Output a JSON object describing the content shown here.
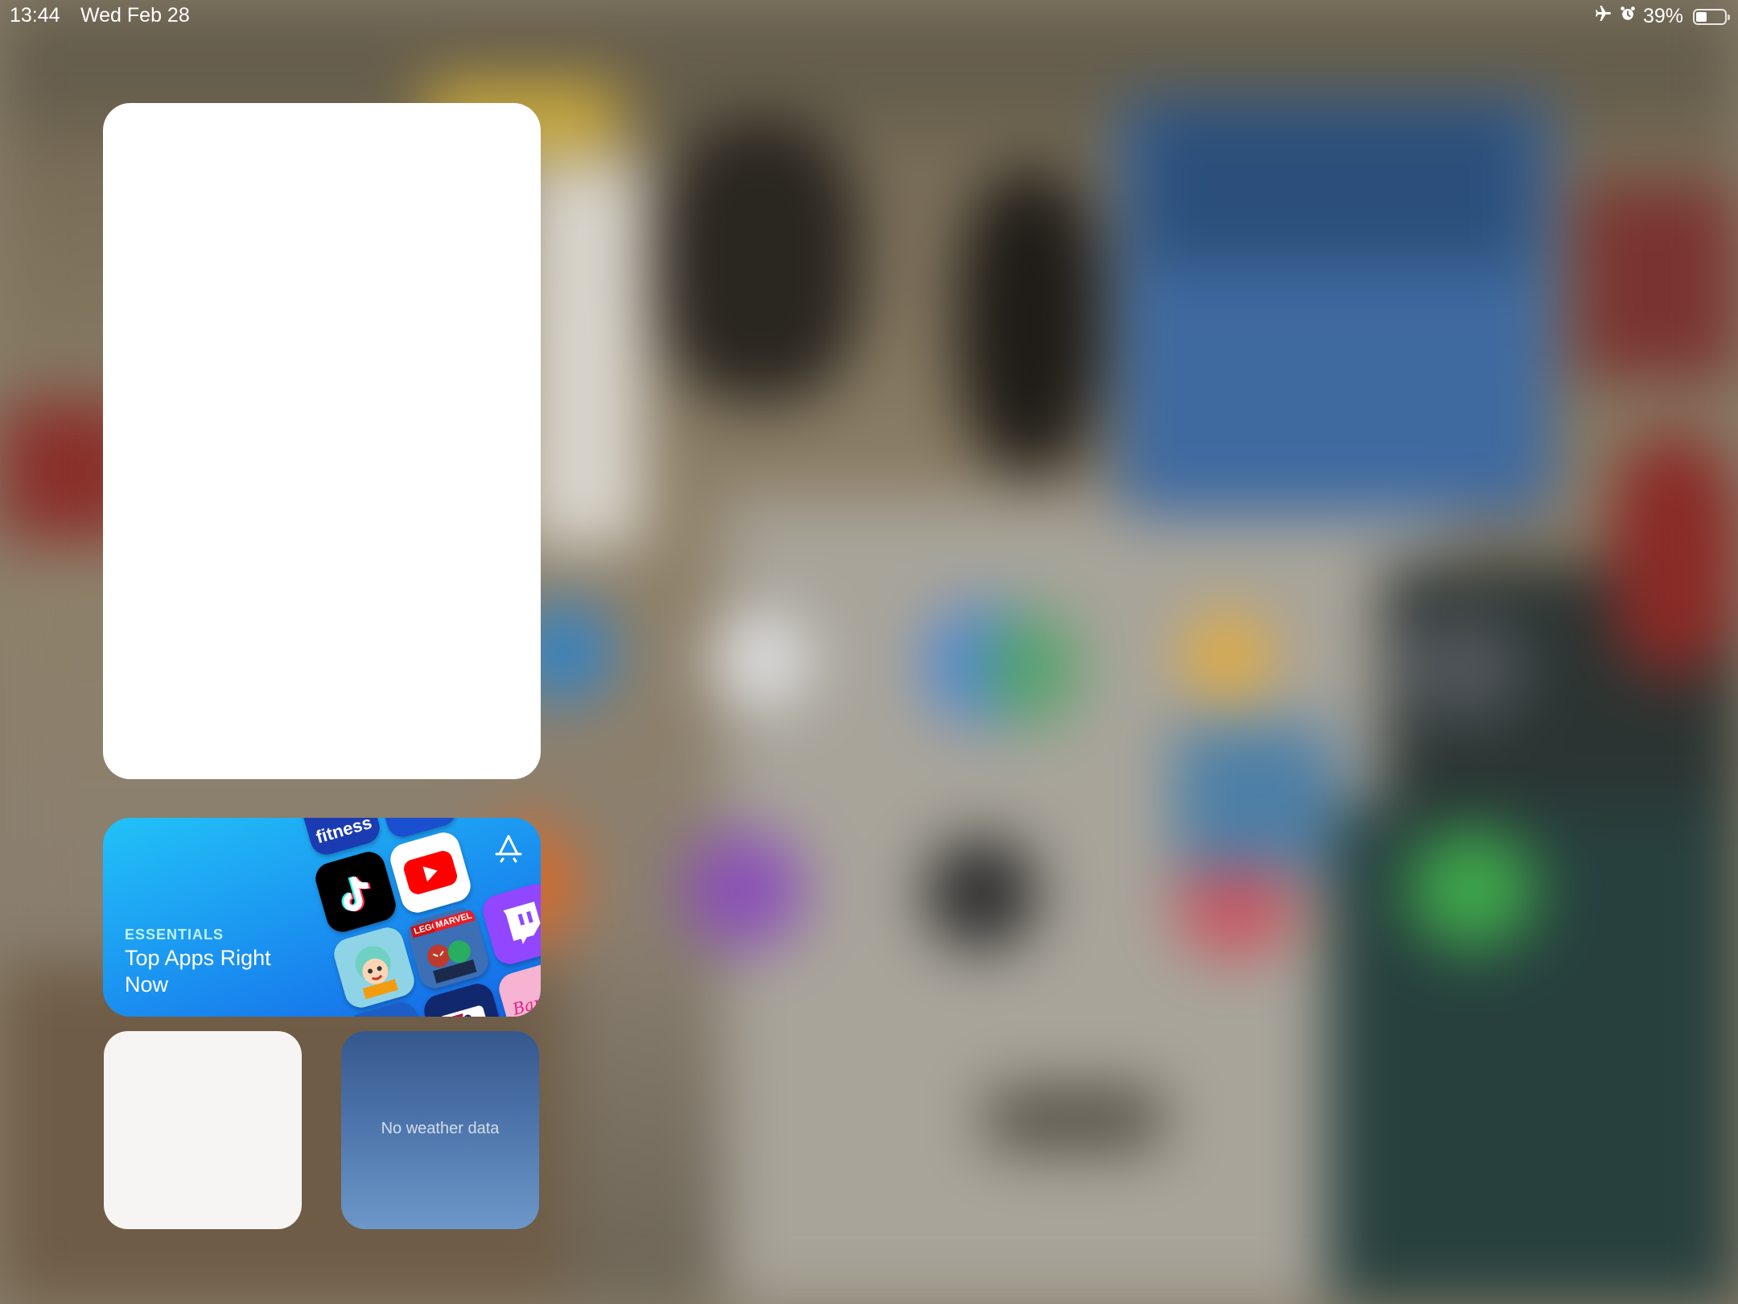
{
  "status_bar": {
    "time": "13:44",
    "date": "Wed Feb 28",
    "battery_percent": "39%",
    "battery_level": 0.39,
    "icons": [
      "airplane-mode-icon",
      "alarm-icon",
      "battery-icon"
    ]
  },
  "widgets": {
    "app_store": {
      "kicker": "ESSENTIALS",
      "title": "Top Apps Right Now",
      "icon": "app-store-icon",
      "tiles": [
        "tiktok",
        "youtube",
        "twitch",
        "toca-boca",
        "lego-marvel",
        "barbie",
        "mlb"
      ],
      "tile_texts": {
        "top": "fitness",
        "lego": "LEGO",
        "marvel": "MARVEL",
        "barbie": "Barbie"
      }
    },
    "weather": {
      "message": "No weather data"
    }
  },
  "colors": {
    "app_store_gradient": [
      "#22c2f7",
      "#1565e6"
    ],
    "weather_gradient": [
      "#34588e",
      "#6d97c8"
    ]
  }
}
